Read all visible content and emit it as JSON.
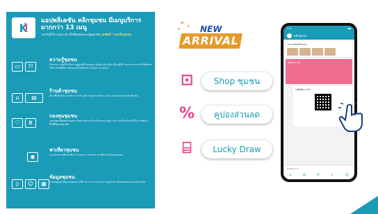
{
  "colors": {
    "teal": "#1a9bb7",
    "pink": "#e6428a",
    "orange": "#e69a2a",
    "navy": "#1f4fb4"
  },
  "left": {
    "title": "แอปพลิเคชัน คลิกชุมชน มีเมนูบริการมากกว่า 13 เมนู",
    "desc_prefix": "รองรับผู้ใช้งานทุกระดับ ทั้งนิติบุคคลและผู้อยู่อาศัย",
    "desc_highlight": "เอกสิทธิ์ / ครบเรื่องชุมชน",
    "sections": [
      {
        "heading": "ความรู้ชุมชน",
        "icons": [
          "monitor-icon",
          "faq-icon"
        ],
        "glyphs": [
          "▭",
          "?!"
        ],
        "text": "ค้นหาความรู้เกี่ยวกับการอยู่อาศัยในชุมชน ข้อมูลกฎระเบียบ ข้อปฏิบัติ และข่าวสารจากนิติบุคคล ได้ครบในที่เดียว พร้อมแชร์ให้เพื่อนบ้านได้อย่างง่ายดาย"
      },
      {
        "heading": "ร้านค้าชุมชน",
        "icons": [
          "shop-icon",
          "pos-icon"
        ],
        "glyphs": [
          "⌂",
          "▤"
        ],
        "text": "เลือกซื้อสินค้าและบริการจากร้านค้าในชุมชน สั่งง่าย ส่งไว สนับสนุนธุรกิจในท้องถิ่น"
      },
      {
        "heading": "กองทุนชุมชน",
        "icons": [
          "hands-icon",
          "money-icon"
        ],
        "glyphs": [
          "♡",
          "฿"
        ],
        "text": "ระดมทุนเพื่อพัฒนาชุมชน ติดตามความโปร่งใสของกองทุน และร่วมเป็นส่วนหนึ่งในการพัฒนาพื้นที่ที่คุณอยู่อาศัย"
      },
      {
        "heading": "พาเที่ยวชุมชน",
        "icons": [
          "location-icon"
        ],
        "glyphs": [
          "◉"
        ],
        "text": "แนะนำสถานที่ท่องเที่ยว ร้านอาหาร และกิจกรรมที่น่าสนใจรอบชุมชน"
      },
      {
        "heading": "ข้อมูลชุมชน",
        "icons": [
          "document-icon",
          "person-icon",
          "grid-icon"
        ],
        "glyphs": [
          "▯",
          "☺",
          "▦"
        ],
        "text": "รวมข้อมูลสำคัญของชุมชน สถิติ ประชากร และสาธารณูปโภค พร้อมอัปเดตอย่างสม่ำเสมอ"
      }
    ]
  },
  "badge": {
    "new": "NEW",
    "arrival": "ARRIVAL"
  },
  "menus": [
    {
      "icon": "shop-bag-icon",
      "glyph": "⊡",
      "label": "Shop ชุมชน"
    },
    {
      "icon": "coupon-icon",
      "glyph": "%",
      "label": "คูปองส่วนลด"
    },
    {
      "icon": "gift-icon",
      "glyph": "⌸",
      "label": "Lucky Draw"
    }
  ],
  "phone": {
    "time": "9:41",
    "community": "คลิกชุมชน",
    "card_title": "รายการสินค้าที่แนะนำ",
    "pink_title": "ข้อมูลประกาศ",
    "chat_title": "รับสิทธิ์ลุ้นรางวัล",
    "input_placeholder": "พิมพ์ข้อความ",
    "nav": [
      "⌂",
      "☰",
      "K",
      "♫",
      "☺"
    ]
  }
}
